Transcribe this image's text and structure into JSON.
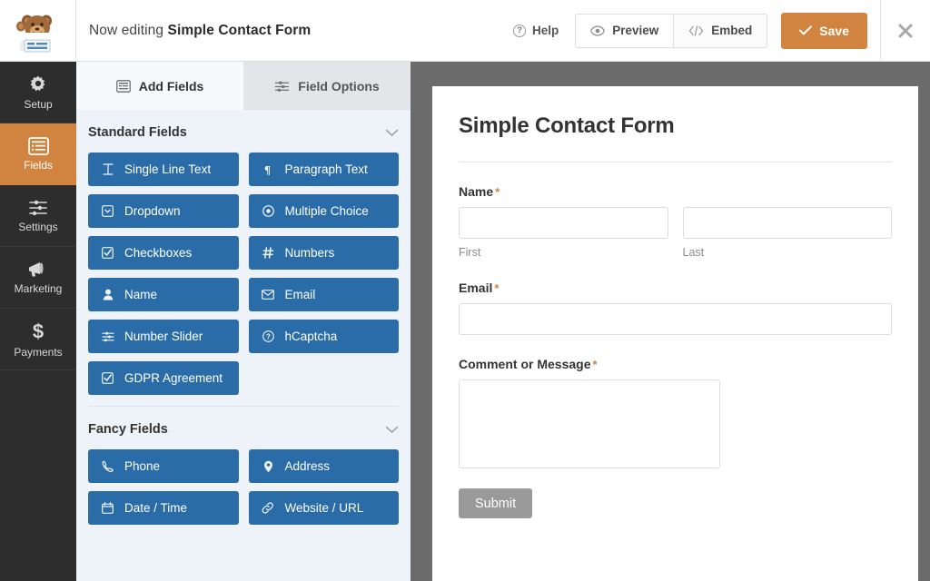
{
  "header": {
    "logo_icon": "wpforms-bear-mascot-icon",
    "editing_prefix": "Now editing",
    "form_name": "Simple Contact Form",
    "help_label": "Help",
    "help_icon": "question-circle-icon",
    "preview_label": "Preview",
    "preview_icon": "eye-icon",
    "embed_label": "Embed",
    "embed_icon": "code-icon",
    "save_label": "Save",
    "save_icon": "check-icon",
    "close_icon": "close-icon",
    "accent_orange": "#d0843f"
  },
  "sidebar": {
    "items": [
      {
        "label": "Setup",
        "icon": "gear-icon",
        "active": false
      },
      {
        "label": "Fields",
        "icon": "list-panel-icon",
        "active": true
      },
      {
        "label": "Settings",
        "icon": "sliders-icon",
        "active": false
      },
      {
        "label": "Marketing",
        "icon": "megaphone-icon",
        "active": false
      },
      {
        "label": "Payments",
        "icon": "dollar-icon",
        "active": false
      }
    ]
  },
  "panel": {
    "tabs": [
      {
        "label": "Add Fields",
        "icon": "panel-list-icon",
        "active": true
      },
      {
        "label": "Field Options",
        "icon": "sliders-icon",
        "active": false
      }
    ],
    "sections": [
      {
        "title": "Standard Fields",
        "toggle_icon": "chevron-down-icon",
        "fields": [
          {
            "label": "Single Line Text",
            "icon": "text-cursor-icon"
          },
          {
            "label": "Paragraph Text",
            "icon": "pilcrow-icon"
          },
          {
            "label": "Dropdown",
            "icon": "dropdown-icon"
          },
          {
            "label": "Multiple Choice",
            "icon": "radio-icon"
          },
          {
            "label": "Checkboxes",
            "icon": "checkbox-icon"
          },
          {
            "label": "Numbers",
            "icon": "hash-icon"
          },
          {
            "label": "Name",
            "icon": "user-icon"
          },
          {
            "label": "Email",
            "icon": "envelope-icon"
          },
          {
            "label": "Number Slider",
            "icon": "sliders-icon"
          },
          {
            "label": "hCaptcha",
            "icon": "question-circle-icon"
          },
          {
            "label": "GDPR Agreement",
            "icon": "checkbox-icon"
          }
        ]
      },
      {
        "title": "Fancy Fields",
        "toggle_icon": "chevron-down-icon",
        "fields": [
          {
            "label": "Phone",
            "icon": "phone-icon"
          },
          {
            "label": "Address",
            "icon": "map-pin-icon"
          },
          {
            "label": "Date / Time",
            "icon": "calendar-icon"
          },
          {
            "label": "Website / URL",
            "icon": "link-icon"
          }
        ]
      }
    ],
    "button_color": "#2a6ca8"
  },
  "form_preview": {
    "title": "Simple Contact Form",
    "required_mark": "*",
    "fields": [
      {
        "label": "Name",
        "required": true,
        "type": "name",
        "subfields": [
          {
            "sublabel": "First",
            "value": ""
          },
          {
            "sublabel": "Last",
            "value": ""
          }
        ]
      },
      {
        "label": "Email",
        "required": true,
        "type": "text",
        "value": ""
      },
      {
        "label": "Comment or Message",
        "required": true,
        "type": "textarea",
        "value": ""
      }
    ],
    "submit_label": "Submit",
    "submit_color": "#9a9a9a"
  }
}
